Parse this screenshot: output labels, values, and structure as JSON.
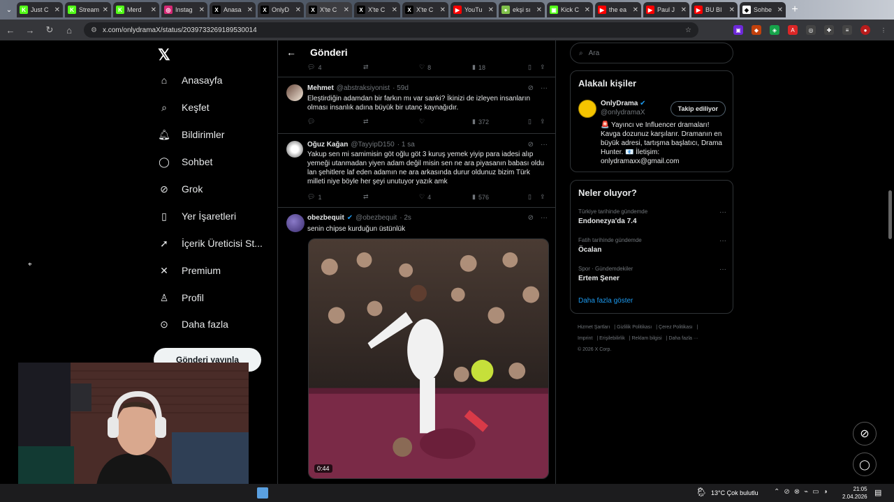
{
  "browser": {
    "tabs": [
      {
        "label": "Just C",
        "color": "#53fc18",
        "glyph": "K"
      },
      {
        "label": "Stream",
        "color": "#53fc18",
        "glyph": "K"
      },
      {
        "label": "Merd",
        "color": "#53fc18",
        "glyph": "K"
      },
      {
        "label": "Instag",
        "color": "#d62976",
        "glyph": "◎"
      },
      {
        "label": "Anasa",
        "color": "#000000",
        "glyph": "X"
      },
      {
        "label": "OnlyD",
        "color": "#000000",
        "glyph": "X"
      },
      {
        "label": "X'te C",
        "color": "#000000",
        "glyph": "X"
      },
      {
        "label": "X'te C",
        "color": "#000000",
        "glyph": "X"
      },
      {
        "label": "X'te C",
        "color": "#000000",
        "glyph": "X"
      },
      {
        "label": "YouTu",
        "color": "#ff0000",
        "glyph": "▶"
      },
      {
        "label": "ekşi sı",
        "color": "#81c14b",
        "glyph": "●"
      },
      {
        "label": "Kick C",
        "color": "#53fc18",
        "glyph": "▣"
      },
      {
        "label": "the ea",
        "color": "#ff0000",
        "glyph": "▶"
      },
      {
        "label": "Paul J",
        "color": "#ff0000",
        "glyph": "▶"
      },
      {
        "label": "BU BI",
        "color": "#ff0000",
        "glyph": "▶"
      },
      {
        "label": "Sohbe",
        "color": "#ffffff",
        "glyph": "◆"
      }
    ],
    "active_tab_index": 6,
    "url": "x.com/onlydramaX/status/2039733269189530014"
  },
  "nav": {
    "items": [
      {
        "label": "Anasayfa",
        "icon": "home-icon"
      },
      {
        "label": "Keşfet",
        "icon": "search-icon"
      },
      {
        "label": "Bildirimler",
        "icon": "bell-icon"
      },
      {
        "label": "Sohbet",
        "icon": "chat-icon"
      },
      {
        "label": "Grok",
        "icon": "grok-icon"
      },
      {
        "label": "Yer İşaretleri",
        "icon": "bookmark-icon"
      },
      {
        "label": "İçerik Üreticisi St...",
        "icon": "rocket-icon"
      },
      {
        "label": "Premium",
        "icon": "x-icon"
      },
      {
        "label": "Profil",
        "icon": "person-icon"
      },
      {
        "label": "Daha fazla",
        "icon": "more-circle-icon"
      }
    ],
    "post_button": "Gönderi yayınla"
  },
  "center": {
    "title": "Gönderi",
    "top_actions": {
      "replies": "4",
      "likes": "8",
      "views": "18"
    },
    "tweets": [
      {
        "name": "Mehmet",
        "handle": "@abstraksiyonist",
        "time": "· 59d",
        "text": "Eleştirdiğin adamdan bir farkın mı var sanki? İkinizi de izleyen insanların olması insanlık adına büyük bir utanç kaynağıdır.",
        "replies": "",
        "retweets": "",
        "likes": "",
        "views": "372"
      },
      {
        "name": "Oğuz Kağan",
        "handle": "@TayyipD150",
        "time": "· 1 sa",
        "text": "Yakup sen mi samimisin göt oğlu göt 3 kuruş yemek yiyip para iadesi alıp yemeği utanmadan yiyen adam değil misin sen ne ara piyasanın babası oldu lan şehitlere laf eden adamın ne ara arkasında durur oldunuz bizim Türk milleti niye böyle her şeyi unutuyor yazık amk",
        "replies": "1",
        "retweets": "",
        "likes": "4",
        "views": "576"
      },
      {
        "name": "obezbequit",
        "handle": "@obezbequit",
        "time": "· 2s",
        "text": "senin chipse kurduğun üstünlük",
        "video_duration": "0:44"
      }
    ]
  },
  "right": {
    "search_placeholder": "Ara",
    "people_title": "Alakalı kişiler",
    "person": {
      "name": "OnlyDrama",
      "handle": "@onlydramaX",
      "follow_label": "Takip ediliyor",
      "bio": "🚨 Yayıncı ve Influencer dramaları! Kavga dozunuz karşılarır. Dramanın en büyük adresi, tartışma başlatıcı, Drama Hunter. 📧 İletişim: onlydramaxx@gmail.com"
    },
    "trends_title": "Neler oluyor?",
    "trends": [
      {
        "context": "Türkiye tarihinde gündemde",
        "name": "Endonezya'da 7.4"
      },
      {
        "context": "Fatih tarihinde gündemde",
        "name": "Öcalan"
      },
      {
        "context": "Spor · Gündemdekiler",
        "name": "Ertem Şener"
      }
    ],
    "show_more": "Daha fazla göster",
    "footer": [
      "Hizmet Şartları",
      "Gizlilik Politikası",
      "Çerez Politikası",
      "Imprint",
      "Erişilebilirlik",
      "Reklam bilgisi",
      "Daha fazla ···",
      "© 2026 X Corp."
    ]
  },
  "taskbar": {
    "weather": "13°C  Çok bulutlu",
    "time": "21:05",
    "date": "2.04.2026"
  },
  "colors": {
    "accent": "#1d9bf0",
    "border": "#2f3336",
    "muted": "#71767b"
  }
}
